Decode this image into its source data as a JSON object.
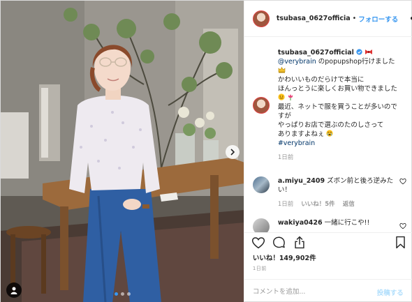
{
  "header": {
    "username": "tsubasa_0627officia",
    "separator": "•",
    "follow_label": "フォローする",
    "more_label": "•••"
  },
  "caption": {
    "username": "tsubasa_0627official",
    "verified_icon": "verified-badge-icon",
    "mention": "@verybrain",
    "line1_rest": " のpopupshop行けました",
    "line2": "かわいいものだらけで本当に",
    "line3": "ほんっとうに楽しくお買い物できました",
    "line4": "最近、ネットで服を買うことが多いので",
    "line5": "すが",
    "line6": "やっぱりお店で選ぶのたのしさって",
    "line7": "ありますよねぇ",
    "hashtag": "#verybrain",
    "time": "1日前",
    "emoji": [
      "red-bow-emoji",
      "crown-emoji",
      "smile-emoji",
      "tulip-emoji",
      "crying-emoji"
    ]
  },
  "comments": [
    {
      "username": "a.miyu_2409",
      "text": "ズボン前と後ろ逆みたい！",
      "time": "1日前",
      "likes": "いいね！5件",
      "reply": "返信"
    },
    {
      "username": "wakiya0426",
      "text": "一緒に行こや!!"
    }
  ],
  "actions": {
    "like_icon": "heart-icon",
    "comment_icon": "comment-icon",
    "share_icon": "share-icon",
    "save_icon": "bookmark-icon",
    "likes_label": "いいね！149,902件",
    "date": "1日前"
  },
  "add_comment": {
    "placeholder": "コメントを追加...",
    "post_label": "投稿する"
  },
  "carousel": {
    "next_icon": "chevron-right-icon",
    "tag_icon": "user-tag-icon",
    "active_index": 0,
    "total": 3
  },
  "colors": {
    "link_blue": "#3897f0",
    "mention_navy": "#003569",
    "border": "#dbdbdb",
    "muted": "#999999",
    "post_disabled": "#b2dffc"
  }
}
